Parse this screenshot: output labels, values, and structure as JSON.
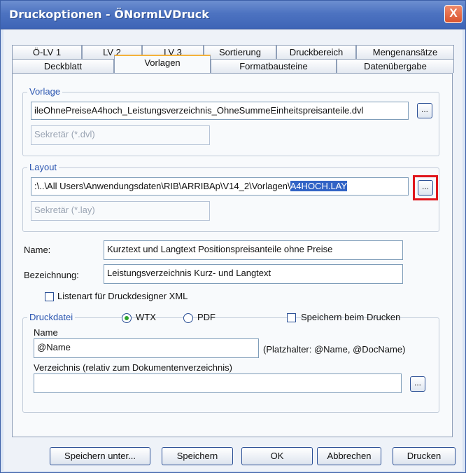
{
  "window": {
    "title": "Druckoptionen - ÖNormLVDruck",
    "close_glyph": "X"
  },
  "tabs": {
    "row1": [
      "Ö-LV 1",
      "LV 2",
      "LV 3",
      "Sortierung",
      "Druckbereich",
      "Mengenansätze"
    ],
    "row2": [
      "Deckblatt",
      "Vorlagen",
      "Formatbausteine",
      "Datenübergabe"
    ],
    "active": "Vorlagen"
  },
  "vorlage": {
    "label": "Vorlage",
    "path": "ileOhnePreiseA4hoch_Leistungsverzeichnis_OhneSummeEinheitspreisanteile.dvl",
    "filter": "Sekretär (*.dvl)",
    "browse_label": "..."
  },
  "layout": {
    "label": "Layout",
    "path_prefix": ":\\..\\All Users\\Anwendungsdaten\\RIB\\ARRIBAp\\V14_2\\Vorlagen\\",
    "path_selected": "A4HOCH.LAY",
    "filter": "Sekretär (*.lay)",
    "browse_label": "..."
  },
  "name_row": {
    "label": "Name:",
    "value": "Kurztext und Langtext Positionspreisanteile ohne Preise"
  },
  "bezeichnung_row": {
    "label": "Bezeichnung:",
    "value": "Leistungsverzeichnis Kurz- und Langtext"
  },
  "listenart": {
    "label": "Listenart für Druckdesigner XML",
    "checked": false
  },
  "druckdatei": {
    "label": "Druckdatei",
    "radio_wtx": "WTX",
    "radio_pdf": "PDF",
    "selected": "WTX",
    "save_on_print": "Speichern beim Drucken",
    "name_label": "Name",
    "name_value": "@Name",
    "placeholder_hint": "(Platzhalter: @Name, @DocName)",
    "dir_label": "Verzeichnis (relativ zum Dokumentenverzeichnis)",
    "dir_value": "",
    "browse_label": "..."
  },
  "buttons": {
    "save_as": "Speichern unter...",
    "save": "Speichern",
    "ok": "OK",
    "cancel": "Abbrechen",
    "print": "Drucken"
  }
}
